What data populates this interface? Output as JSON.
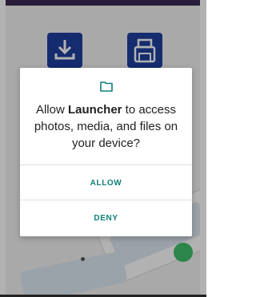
{
  "dialog": {
    "message_prefix": "Allow ",
    "app_name": "Launcher",
    "message_suffix": " to access photos, media, and files on your device?",
    "allow_label": "ALLOW",
    "deny_label": "DENY",
    "icon": "folder-icon"
  },
  "background_app": {
    "icons": [
      "download-icon",
      "printer-icon"
    ]
  },
  "colors": {
    "accent": "#107f7a",
    "app_icon_bg": "#1f3fa0",
    "status_bar": "#3a2c55"
  }
}
